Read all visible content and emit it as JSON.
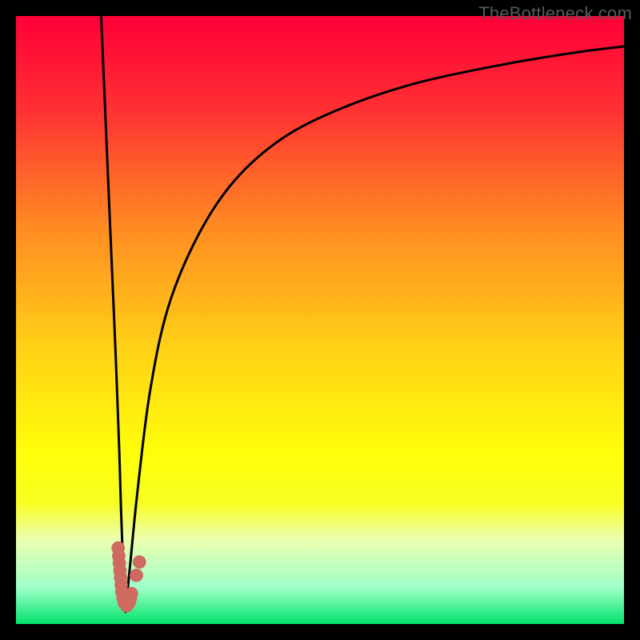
{
  "watermark": "TheBottleneck.com",
  "colors": {
    "frame": "#000000",
    "curve": "#000000",
    "dot": "#ce6a60",
    "gradient_stops": [
      {
        "offset": 0.0,
        "color": "#ff0037"
      },
      {
        "offset": 0.15,
        "color": "#ff2f33"
      },
      {
        "offset": 0.35,
        "color": "#ff8c22"
      },
      {
        "offset": 0.55,
        "color": "#ffd215"
      },
      {
        "offset": 0.72,
        "color": "#ffff0a"
      },
      {
        "offset": 0.8,
        "color": "#f7ff20"
      },
      {
        "offset": 0.86,
        "color": "#ecffae"
      },
      {
        "offset": 0.94,
        "color": "#9fffc8"
      },
      {
        "offset": 1.0,
        "color": "#00e36a"
      }
    ]
  },
  "chart_data": {
    "type": "line",
    "title": "",
    "xlabel": "",
    "ylabel": "",
    "xlim": [
      0,
      100
    ],
    "ylim": [
      0,
      100
    ],
    "grid": false,
    "legend": false,
    "series": [
      {
        "name": "left-branch",
        "x": [
          14,
          14.6,
          15.2,
          15.8,
          16.4,
          17,
          17.3,
          17.6,
          17.85,
          18.0
        ],
        "y": [
          100,
          86,
          72,
          58,
          44,
          28,
          18,
          10,
          5,
          2
        ]
      },
      {
        "name": "right-branch",
        "x": [
          18.0,
          18.8,
          20,
          22,
          25,
          30,
          36,
          44,
          54,
          66,
          80,
          92,
          100
        ],
        "y": [
          2,
          10,
          22,
          38,
          52,
          64,
          73,
          80,
          85,
          89,
          92,
          94,
          95
        ]
      }
    ],
    "markers": {
      "name": "dot-cluster",
      "points": [
        {
          "x": 16.8,
          "y": 12.5
        },
        {
          "x": 16.9,
          "y": 11.2
        },
        {
          "x": 17.0,
          "y": 10.0
        },
        {
          "x": 17.1,
          "y": 8.8
        },
        {
          "x": 17.2,
          "y": 7.6
        },
        {
          "x": 17.3,
          "y": 6.4
        },
        {
          "x": 17.4,
          "y": 5.3
        },
        {
          "x": 17.6,
          "y": 4.3
        },
        {
          "x": 17.8,
          "y": 3.5
        },
        {
          "x": 18.2,
          "y": 3.0
        },
        {
          "x": 18.6,
          "y": 3.5
        },
        {
          "x": 18.8,
          "y": 4.2
        },
        {
          "x": 19.0,
          "y": 5.0
        },
        {
          "x": 19.8,
          "y": 8.0
        },
        {
          "x": 20.3,
          "y": 10.2
        }
      ],
      "radius_data_units": 1.1
    }
  }
}
